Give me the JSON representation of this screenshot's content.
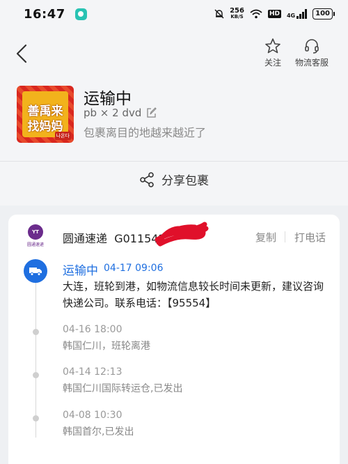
{
  "status_bar": {
    "time": "16:47",
    "net_speed": "256",
    "net_unit": "KB/S",
    "hd": "HD",
    "network": "4G",
    "battery": "100"
  },
  "header": {
    "follow_label": "关注",
    "service_label": "物流客服"
  },
  "package": {
    "thumbnail_text_line1": "善禹来",
    "thumbnail_text_line2": "找妈妈",
    "thumbnail_badge": "나온다",
    "status": "运输中",
    "item": "pb × 2 dvd",
    "subtitle": "包裹离目的地越来越近了"
  },
  "share_label": "分享包裹",
  "courier": {
    "logo_text": "YT",
    "logo_small": "圆通速递",
    "name": "圆通速递",
    "tracking_prefix": "G011542",
    "copy_label": "复制",
    "call_label": "打电话"
  },
  "timeline": {
    "current": {
      "status": "运输中",
      "time": "04-17  09:06",
      "desc": "大连，班轮到港，如物流信息较长时间未更新，建议咨询快递公司。联系电话：【95554】"
    },
    "events": [
      {
        "time": "04-16  18:00",
        "location": "韩国仁川，班轮离港"
      },
      {
        "time": "04-14  12:13",
        "location": "韩国仁川国际转运仓,已发出"
      },
      {
        "time": "04-08  10:30",
        "location": "韩国首尔,已发出"
      }
    ]
  },
  "colors": {
    "accent": "#1f6fe0",
    "courier_brand": "#6b2c8c",
    "redaction": "#e0102a"
  }
}
